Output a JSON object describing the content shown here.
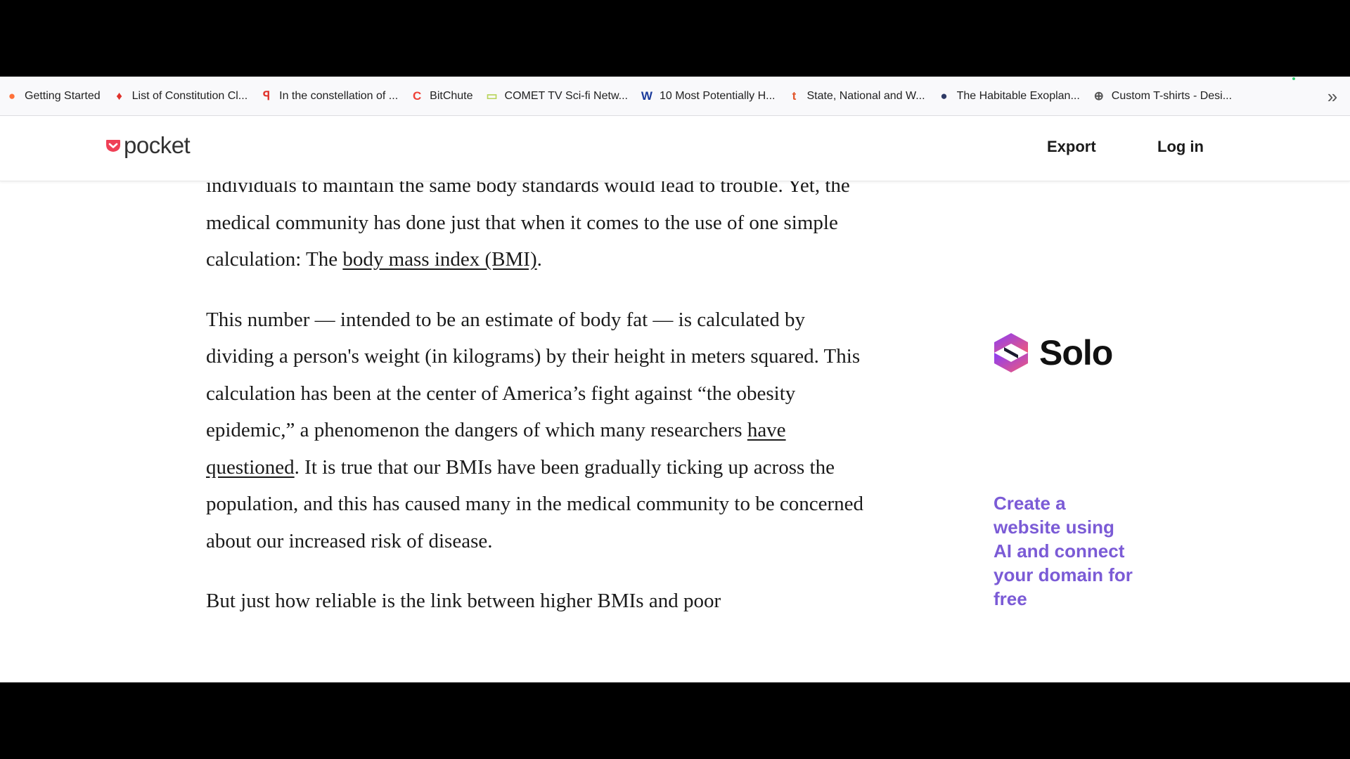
{
  "bookmarks": [
    {
      "label": "Getting Started",
      "icon": "firefox-icon",
      "glyph": "●",
      "color": "#ff7139"
    },
    {
      "label": "List of Constitution Cl...",
      "icon": "flame-icon",
      "glyph": "♦",
      "color": "#e0322b"
    },
    {
      "label": "In the constellation of ...",
      "icon": "flag-icon",
      "glyph": "ꟼ",
      "color": "#e0322b"
    },
    {
      "label": "BitChute",
      "icon": "bitchute-icon",
      "glyph": "C",
      "color": "#ef4137"
    },
    {
      "label": "COMET TV Sci-fi Netw...",
      "icon": "comet-icon",
      "glyph": "▭",
      "color": "#b8d45a"
    },
    {
      "label": "10 Most Potentially H...",
      "icon": "w-logo-icon",
      "glyph": "W",
      "color": "#1c3c9c"
    },
    {
      "label": "State, National and W...",
      "icon": "t-logo-icon",
      "glyph": "t",
      "color": "#e2552b"
    },
    {
      "label": "The Habitable Exoplan...",
      "icon": "planet-icon",
      "glyph": "●",
      "color": "#2e3a66"
    },
    {
      "label": "Custom T-shirts - Desi...",
      "icon": "globe-icon",
      "glyph": "⊕",
      "color": "#555555"
    }
  ],
  "more_icon": "chevron-double-right-icon",
  "header": {
    "logo": "pocket",
    "export_label": "Export",
    "login_label": "Log in"
  },
  "article": {
    "p1_text": "individuals to maintain the same body standards would lead to trouble. Yet, the medical community has done just that when it comes to the use of one simple calculation: The ",
    "p1_link": "body mass index (BMI)",
    "p1_end": ".",
    "p2_text": "This number — intended to be an estimate of body fat — is calculated by dividing a person's weight (in kilograms) by their height in meters squared. This calculation has been at the center of America’s fight against “the obesity epidemic,” a phenomenon the dangers of which many researchers ",
    "p2_link": "have questioned",
    "p2_end": ". It is true that our BMIs have been gradually ticking up across the population, and this has caused many in the medical community to be concerned about our increased risk of disease.",
    "p3_text": "But just how reliable is the link between higher BMIs and poor"
  },
  "ad": {
    "brand": "Solo",
    "tagline": "Create a website using AI and connect your domain for free"
  },
  "colors": {
    "ad_accent": "#7b5bd6",
    "pocket_red": "#ef4056"
  }
}
